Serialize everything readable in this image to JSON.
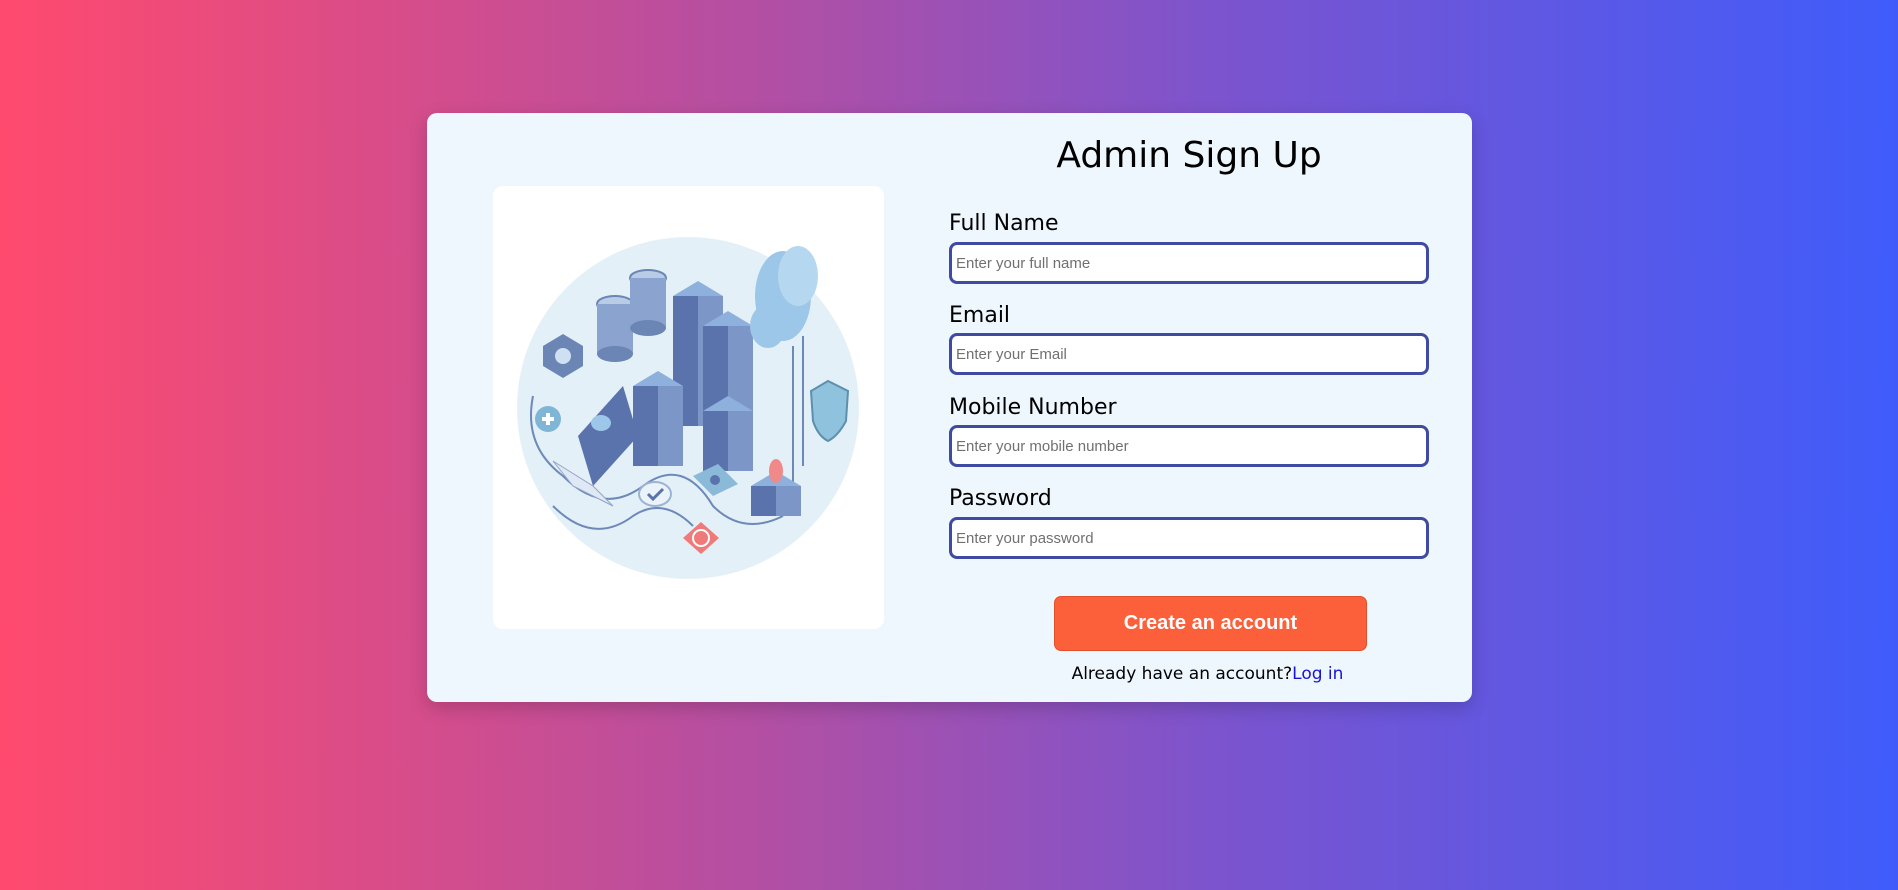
{
  "form": {
    "title": "Admin Sign Up",
    "fields": [
      {
        "label": "Full Name",
        "placeholder": "Enter your full name",
        "value": ""
      },
      {
        "label": "Email",
        "placeholder": "Enter your Email",
        "value": ""
      },
      {
        "label": "Mobile Number",
        "placeholder": "Enter your mobile number",
        "value": ""
      },
      {
        "label": "Password",
        "placeholder": "Enter your password",
        "value": ""
      }
    ],
    "submit_label": "Create an account",
    "login_prompt": "Already have an account?",
    "login_link": "Log in"
  },
  "colors": {
    "gradient_start": "#ff4a6e",
    "gradient_end": "#3f5cfb",
    "card_bg": "#eff7fe",
    "input_border": "#3f4aa3",
    "button_bg": "#fc603a",
    "link": "#1a12d6"
  },
  "illustration": {
    "icons": [
      "server-rack-icon",
      "database-icon",
      "cloud-icon",
      "laptop-icon",
      "shield-icon",
      "fingerprint-icon",
      "padlock-icon"
    ]
  }
}
